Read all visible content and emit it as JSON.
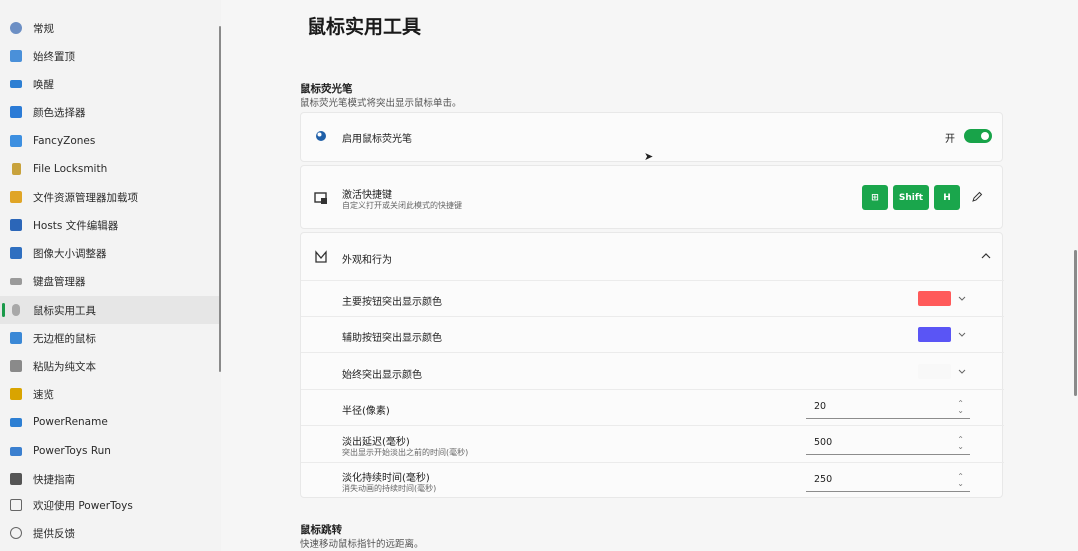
{
  "sidebar": {
    "items": [
      {
        "label": "常规",
        "icon": "gear-icon",
        "color": "#5b7fb8"
      },
      {
        "label": "始终置顶",
        "icon": "pin-window-icon",
        "color": "#4a90d9"
      },
      {
        "label": "唤醒",
        "icon": "coffee-icon",
        "color": "#2d7fd3"
      },
      {
        "label": "颜色选择器",
        "icon": "color-picker-icon",
        "color": "#2b7bd6"
      },
      {
        "label": "FancyZones",
        "icon": "fancyzones-icon",
        "color": "#3d8fe0"
      },
      {
        "label": "File Locksmith",
        "icon": "lock-icon",
        "color": "#c8a23c"
      },
      {
        "label": "文件资源管理器加载项",
        "icon": "explorer-icon",
        "color": "#e0a526"
      },
      {
        "label": "Hosts 文件编辑器",
        "icon": "hosts-icon",
        "color": "#2b66b8"
      },
      {
        "label": "图像大小调整器",
        "icon": "image-resize-icon",
        "color": "#2f6fc0"
      },
      {
        "label": "键盘管理器",
        "icon": "keyboard-icon",
        "color": "#8a8a8a"
      },
      {
        "label": "鼠标实用工具",
        "icon": "mouse-icon",
        "color": "#9a9a9a"
      },
      {
        "label": "无边框的鼠标",
        "icon": "borderless-mouse-icon",
        "color": "#3a88d6"
      },
      {
        "label": "粘贴为纯文本",
        "icon": "paste-icon",
        "color": "#777"
      },
      {
        "label": "速览",
        "icon": "peek-icon",
        "color": "#d9a400"
      },
      {
        "label": "PowerRename",
        "icon": "rename-icon",
        "color": "#2d7fd3"
      },
      {
        "label": "PowerToys Run",
        "icon": "run-icon",
        "color": "#3a7fcf"
      },
      {
        "label": "快捷指南",
        "icon": "shortcut-guide-icon",
        "color": "#555"
      },
      {
        "label": "欢迎使用 PowerToys",
        "icon": "welcome-icon",
        "color": "#666"
      },
      {
        "label": "提供反馈",
        "icon": "feedback-icon",
        "color": "#666"
      }
    ],
    "selected_index": 10
  },
  "page": {
    "title": "鼠标实用工具",
    "section1": {
      "title": "鼠标荧光笔",
      "desc": "鼠标荧光笔模式将突出显示鼠标单击。"
    },
    "enable": {
      "label": "启用鼠标荧光笔",
      "state_text": "开",
      "on": true
    },
    "shortcut": {
      "label": "激活快捷键",
      "desc": "自定义打开或关闭此模式的快捷键",
      "keys": [
        "⊞",
        "Shift",
        "H"
      ]
    },
    "appearance": {
      "label": "外观和行为",
      "primary_color": {
        "label": "主要按钮突出显示颜色",
        "color": "#ff5a5a"
      },
      "secondary_color": {
        "label": "辅助按钮突出显示颜色",
        "color": "#5a55f5"
      },
      "always_color": {
        "label": "始终突出显示颜色",
        "color": ""
      },
      "radius": {
        "label": "半径(像素)",
        "value": "20"
      },
      "fade_delay": {
        "label": "淡出延迟(毫秒)",
        "desc": "突出显示开始淡出之前的时间(毫秒)",
        "value": "500"
      },
      "fade_duration": {
        "label": "淡化持续时间(毫秒)",
        "desc": "消失动画的持续时间(毫秒)",
        "value": "250"
      }
    },
    "section2": {
      "title": "鼠标跳转",
      "desc": "快速移动鼠标指针的远距离。"
    }
  }
}
